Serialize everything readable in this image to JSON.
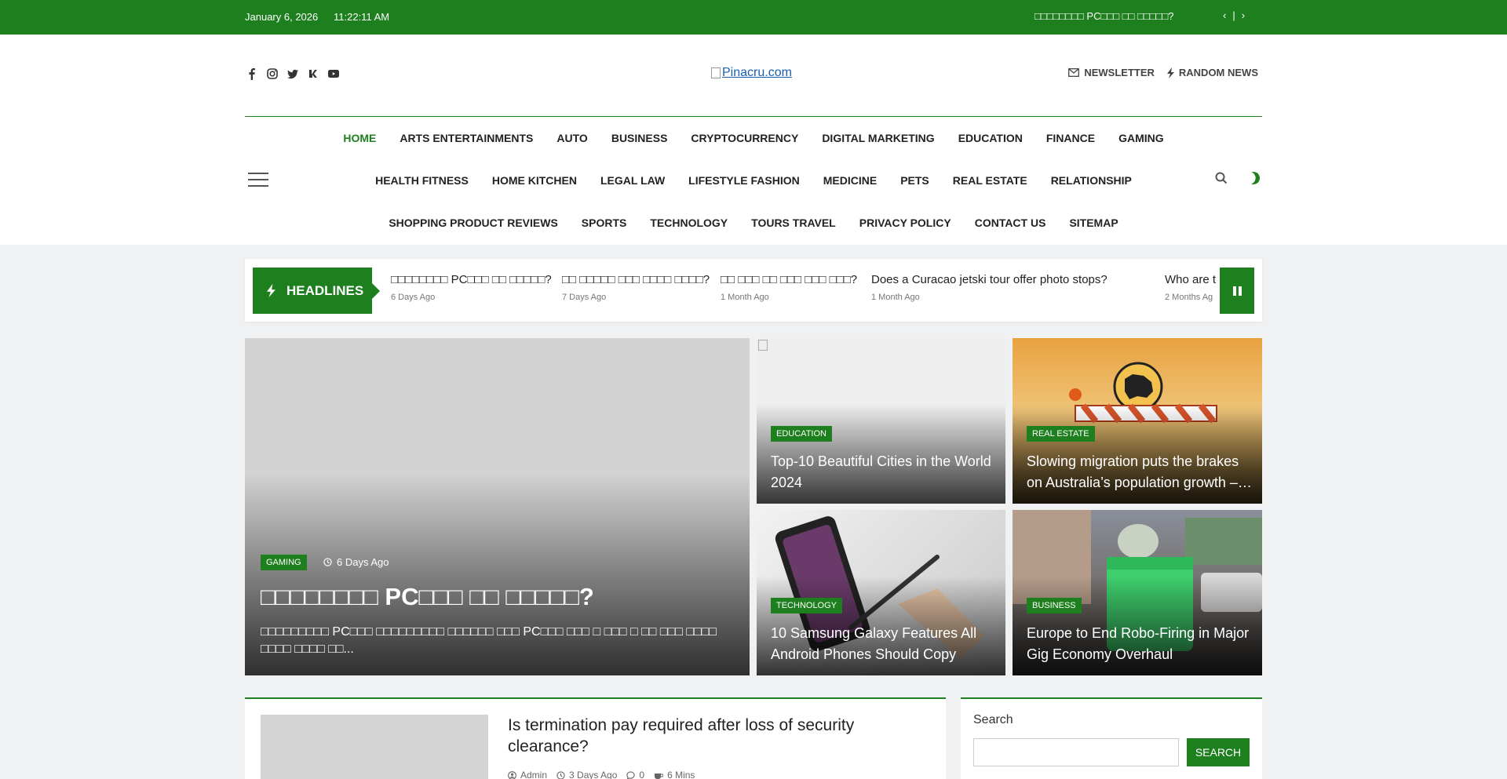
{
  "topbar": {
    "date": "January 6, 2026",
    "time": "11:22:11 AM",
    "ticker": "□□□□□□□□ PC□□□ □□ □□□□□?",
    "prev_icon": "‹",
    "separator": "|",
    "next_icon": "›"
  },
  "header": {
    "social_icons": [
      "facebook-icon",
      "instagram-icon",
      "twitter-icon",
      "vk-icon",
      "youtube-icon"
    ],
    "logo_alt": "Pinacru.com",
    "newsletter_label": "NEWSLETTER",
    "random_news_label": "RANDOM NEWS"
  },
  "nav": {
    "row1": [
      "HOME",
      "ARTS ENTERTAINMENTS",
      "AUTO",
      "BUSINESS",
      "CRYPTOCURRENCY",
      "DIGITAL MARKETING",
      "EDUCATION",
      "FINANCE",
      "GAMING"
    ],
    "row2": [
      "HEALTH FITNESS",
      "HOME KITCHEN",
      "LEGAL LAW",
      "LIFESTYLE FASHION",
      "MEDICINE",
      "PETS",
      "REAL ESTATE",
      "RELATIONSHIP"
    ],
    "row3": [
      "SHOPPING PRODUCT REVIEWS",
      "SPORTS",
      "TECHNOLOGY",
      "TOURS TRAVEL",
      "PRIVACY POLICY",
      "CONTACT US",
      "SITEMAP"
    ]
  },
  "headlines": {
    "label": "HEADLINES",
    "items": [
      {
        "title": "□□□□□□□□ PC□□□ □□ □□□□□?",
        "ago": "6 Days Ago"
      },
      {
        "title": "□□ □□□□□ □□□ □□□□ □□□□?",
        "ago": "7 Days Ago"
      },
      {
        "title": "□□ □□□ □□ □□□ □□□ □□□?",
        "ago": "1 Month Ago"
      },
      {
        "title": "Does a Curacao jetski tour offer photo stops?",
        "ago": "1 Month Ago"
      },
      {
        "title": "Who are t",
        "ago": "2 Months Ag"
      }
    ]
  },
  "feature": {
    "main": {
      "category": "GAMING",
      "ago": "6 Days Ago",
      "title": "□□□□□□□□ PC□□□ □□ □□□□□?",
      "excerpt": "□□□□□□□□□ PC□□□ □□□□□□□□□ □□□□□□ □□□ PC□□□ □□□ □ □□□ □ □□ □□□ □□□□ □□□□ □□□□ □□..."
    },
    "cards": [
      {
        "category": "EDUCATION",
        "title": "Top-10 Beautiful Cities in the World 2024"
      },
      {
        "category": "REAL ESTATE",
        "title": "Slowing migration puts the brakes on Australia’s population growth –…"
      },
      {
        "category": "TECHNOLOGY",
        "title": "10 Samsung Galaxy Features All Android Phones Should Copy"
      },
      {
        "category": "BUSINESS",
        "title": "Europe to End Robo-Firing in Major Gig Economy Overhaul"
      }
    ]
  },
  "article": {
    "title": "Is termination pay required after loss of security clearance?",
    "author": "Admin",
    "ago": "3 Days Ago",
    "comments": "0",
    "read_time": "6 Mins"
  },
  "sidebar": {
    "search_label": "Search",
    "search_value": "",
    "search_button": "SEARCH"
  },
  "colors": {
    "accent": "#1e7f1e"
  }
}
